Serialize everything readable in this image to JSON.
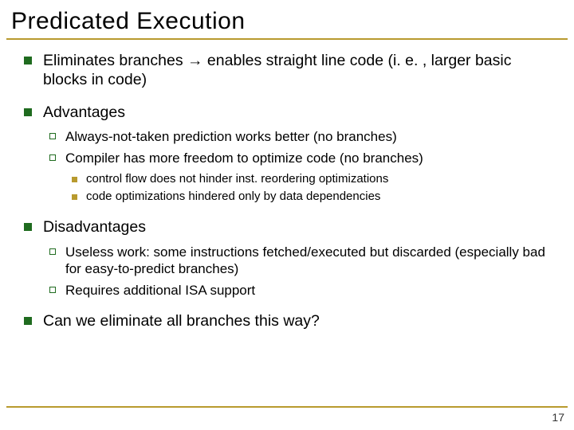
{
  "title": "Predicated Execution",
  "bullets": {
    "b1_pre": "Eliminates branches ",
    "b1_arrow": "→",
    "b1_post": " enables straight line code (i. e. , larger basic blocks in code)",
    "b2": "Advantages",
    "b2_1": "Always-not-taken prediction works better (no branches)",
    "b2_2": "Compiler has more freedom to optimize code (no branches)",
    "b2_2_1": "control flow does not hinder inst. reordering optimizations",
    "b2_2_2": "code optimizations hindered only by data dependencies",
    "b3": "Disadvantages",
    "b3_1": "Useless work: some instructions fetched/executed but discarded (especially bad for easy-to-predict branches)",
    "b3_2": "Requires additional ISA support",
    "b4": "Can we eliminate all branches this way?"
  },
  "page_number": "17"
}
